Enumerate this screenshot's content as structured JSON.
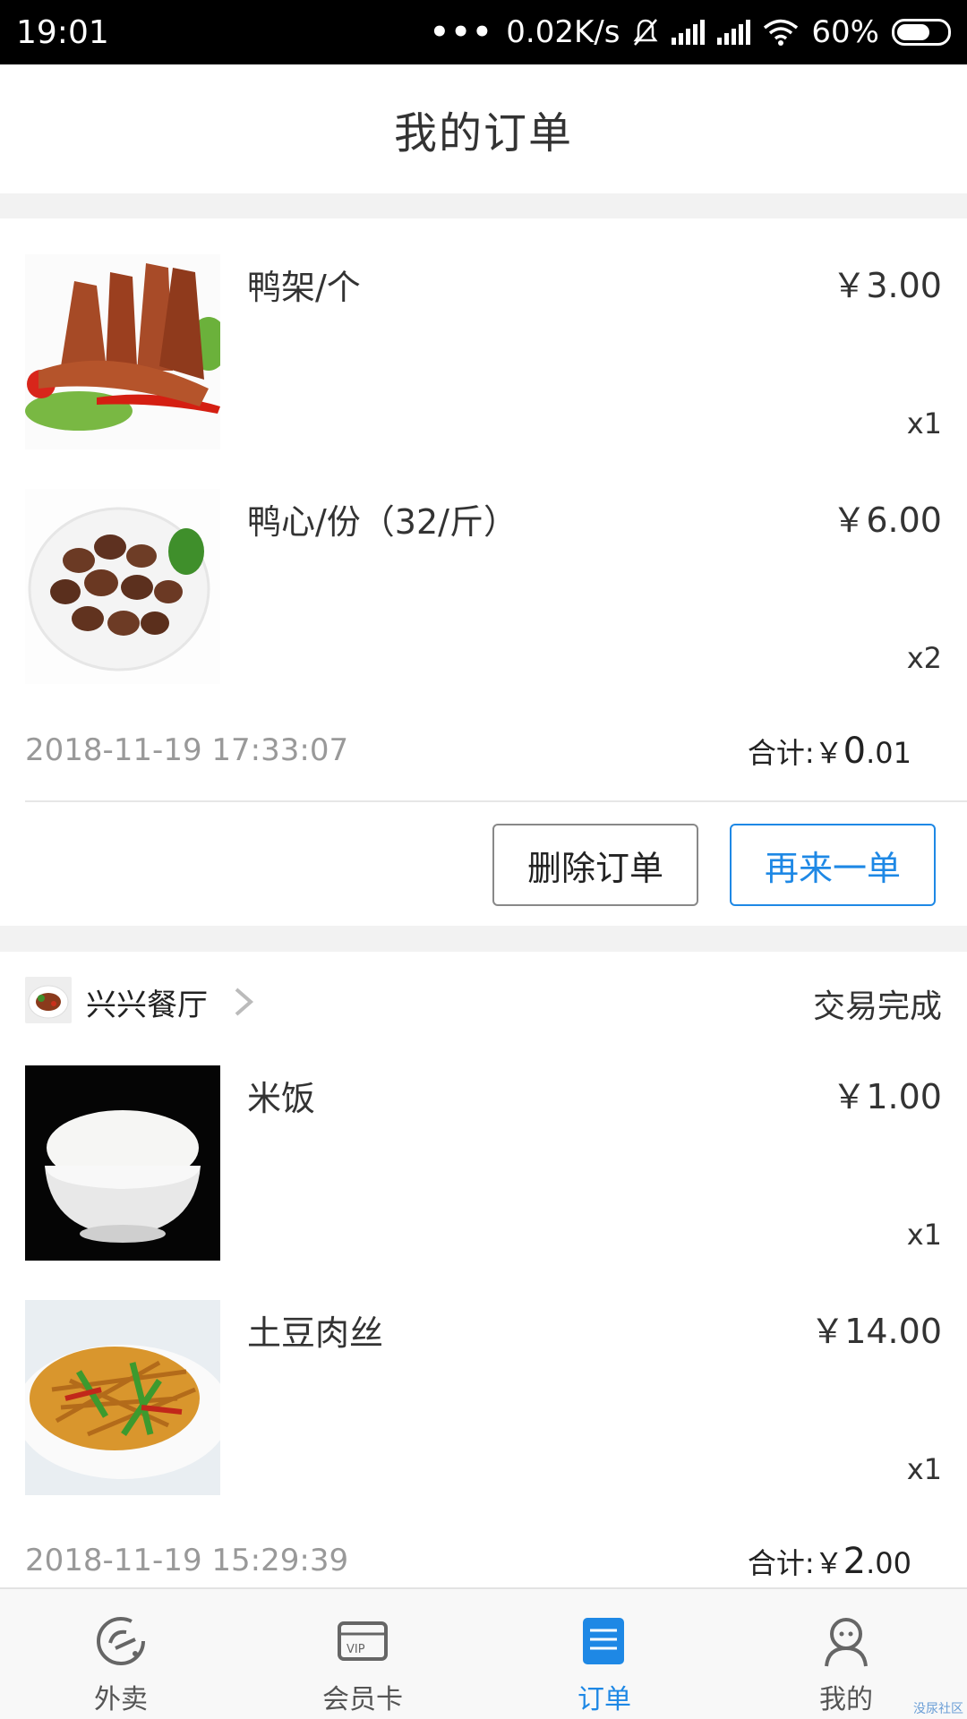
{
  "status_bar": {
    "time": "19:01",
    "network_speed": "0.02K/s",
    "battery": "60%"
  },
  "header": {
    "title": "我的订单"
  },
  "orders": [
    {
      "items": [
        {
          "name": "鸭架/个",
          "price": "￥3.00",
          "qty": "x1"
        },
        {
          "name": "鸭心/份（32/斤）",
          "price": "￥6.00",
          "qty": "x2"
        }
      ],
      "time": "2018-11-19 17:33:07",
      "total_label": "合计:￥",
      "total_int": "0",
      "total_dec": ".01",
      "actions": {
        "delete": "删除订单",
        "reorder": "再来一单"
      }
    },
    {
      "shop": {
        "name": "兴兴餐厅",
        "status": "交易完成"
      },
      "items": [
        {
          "name": "米饭",
          "price": "￥1.00",
          "qty": "x1"
        },
        {
          "name": "土豆肉丝",
          "price": "￥14.00",
          "qty": "x1"
        }
      ],
      "time": "2018-11-19 15:29:39",
      "total_label": "合计:￥",
      "total_int": "2",
      "total_dec": ".00"
    }
  ],
  "tabs": [
    {
      "label": "外卖",
      "icon": "takeout-icon",
      "active": false
    },
    {
      "label": "会员卡",
      "icon": "vip-card-icon",
      "active": false
    },
    {
      "label": "订单",
      "icon": "order-list-icon",
      "active": true
    },
    {
      "label": "我的",
      "icon": "profile-icon",
      "active": false
    }
  ],
  "watermark": "没尿社区",
  "colors": {
    "accent": "#1e88e5",
    "muted": "#999999",
    "background": "#f2f2f2"
  }
}
